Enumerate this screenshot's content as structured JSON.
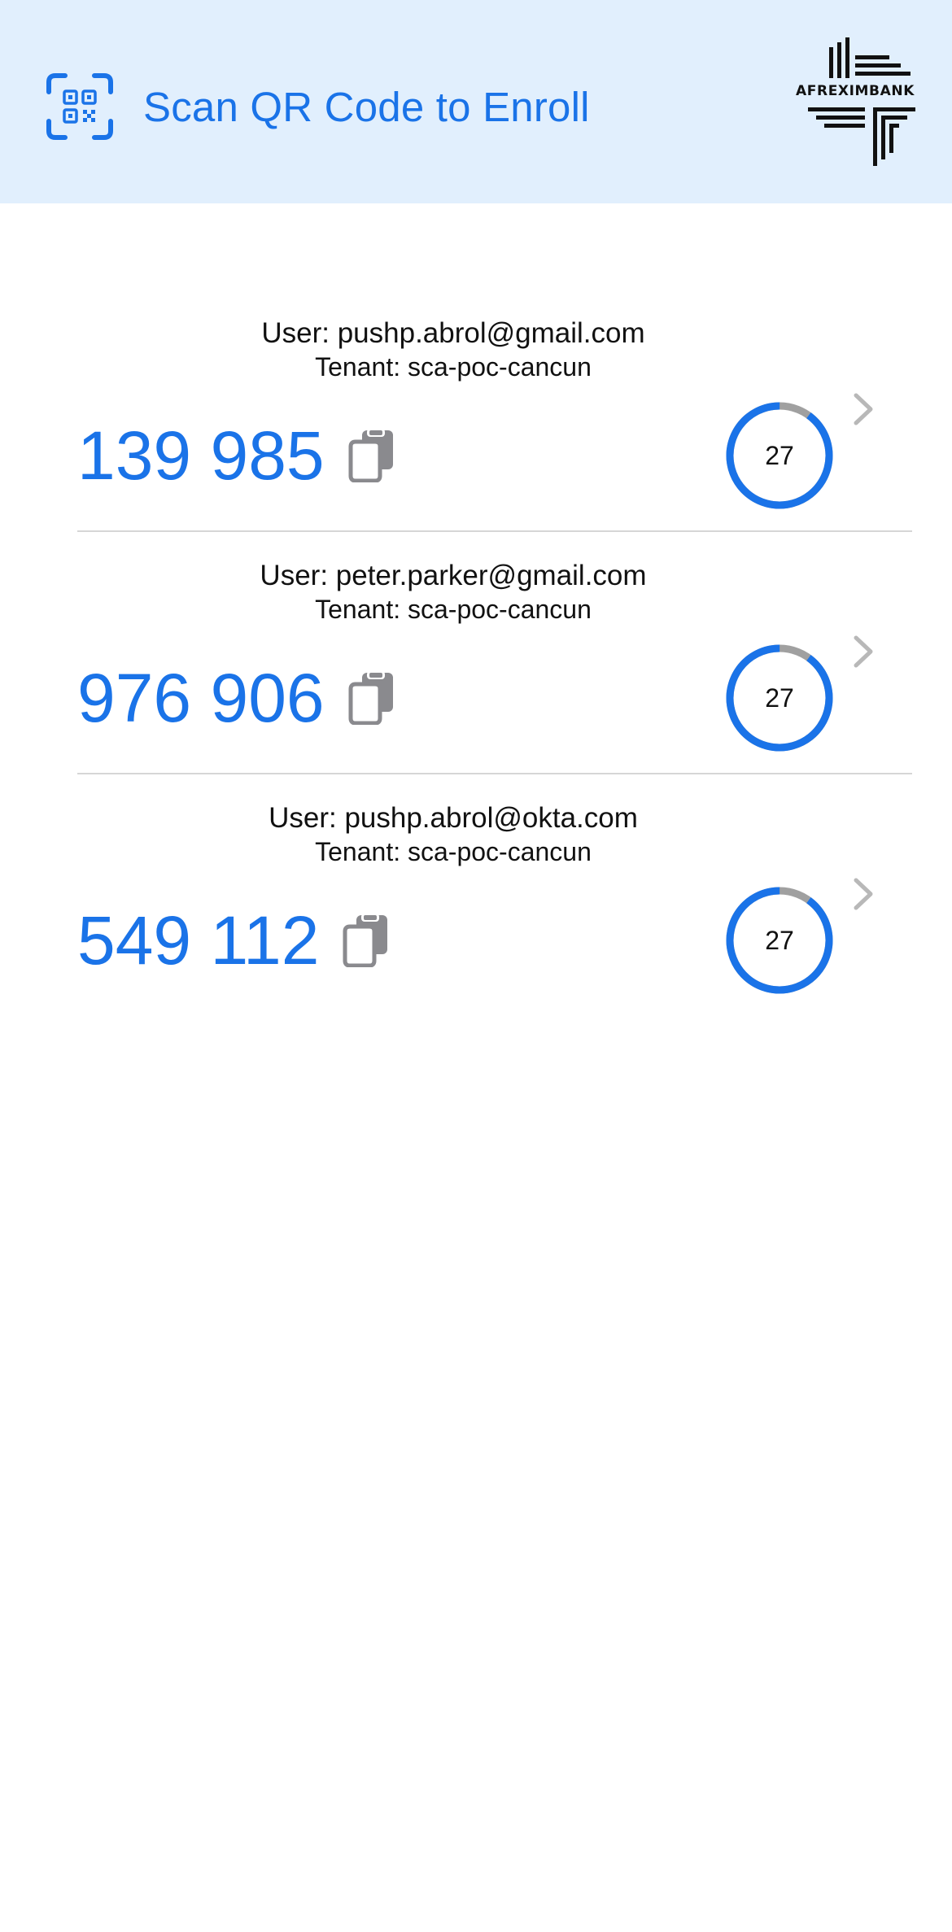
{
  "header": {
    "scan_label": "Scan QR Code to Enroll",
    "scan_icon": "qr-scan-icon",
    "logo_text": "AFREXIMBANK"
  },
  "colors": {
    "accent": "#1a73e8",
    "header_bg": "#e1effd",
    "timer_track": "#a0a0a0",
    "divider": "#d6d6d6",
    "icon_gray": "#8a8a8e"
  },
  "accounts": [
    {
      "user": "User: pushp.abrol@gmail.com",
      "tenant": "Tenant: sca-poc-cancun",
      "code": "139 985",
      "seconds_left": "27",
      "timer_fraction": 0.9
    },
    {
      "user": "User: peter.parker@gmail.com",
      "tenant": "Tenant: sca-poc-cancun",
      "code": "976 906",
      "seconds_left": "27",
      "timer_fraction": 0.9
    },
    {
      "user": "User: pushp.abrol@okta.com",
      "tenant": "Tenant: sca-poc-cancun",
      "code": "549 112",
      "seconds_left": "27",
      "timer_fraction": 0.9
    }
  ]
}
